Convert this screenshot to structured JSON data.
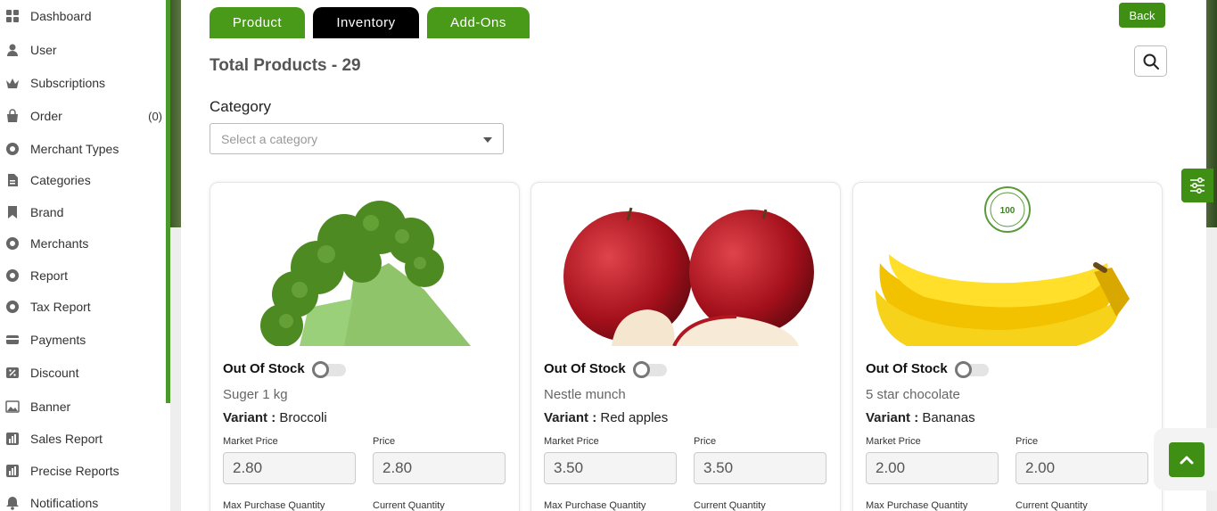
{
  "sidebar": {
    "items": [
      {
        "label": "Dashboard",
        "icon": "grid-icon"
      },
      {
        "label": "User",
        "icon": "user-icon"
      },
      {
        "label": "Subscriptions",
        "icon": "crown-icon"
      },
      {
        "label": "Order",
        "icon": "bag-icon",
        "count": "(0)"
      },
      {
        "label": "Merchant Types",
        "icon": "gear-icon"
      },
      {
        "label": "Categories",
        "icon": "document-icon"
      },
      {
        "label": "Brand",
        "icon": "bookmark-icon"
      },
      {
        "label": "Merchants",
        "icon": "gear-icon"
      },
      {
        "label": "Report",
        "icon": "gear-icon"
      },
      {
        "label": "Tax Report",
        "icon": "gear-icon"
      },
      {
        "label": "Payments",
        "icon": "card-icon"
      },
      {
        "label": "Discount",
        "icon": "percent-icon"
      },
      {
        "label": "Banner",
        "icon": "image-icon"
      },
      {
        "label": "Sales Report",
        "icon": "chart-icon"
      },
      {
        "label": "Precise Reports",
        "icon": "chart-icon"
      },
      {
        "label": "Notifications",
        "icon": "bell-icon"
      }
    ]
  },
  "tabs": [
    {
      "label": "Product",
      "active": false
    },
    {
      "label": "Inventory",
      "active": true
    },
    {
      "label": "Add-Ons",
      "active": false
    }
  ],
  "header": {
    "back_label": "Back",
    "title": "Total Products - 29"
  },
  "filter": {
    "category_label": "Category",
    "category_placeholder": "Select a category"
  },
  "products": [
    {
      "image": "broccoli",
      "out_of_stock_label": "Out Of Stock",
      "out_of_stock": false,
      "name": "Suger 1 kg",
      "variant_label": "Variant :",
      "variant": "Broccoli",
      "market_price_label": "Market Price",
      "market_price": "2.80",
      "price_label": "Price",
      "price": "2.80",
      "max_qty_label": "Max Purchase Quantity",
      "current_qty_label": "Current Quantity"
    },
    {
      "image": "red-apples",
      "out_of_stock_label": "Out Of Stock",
      "out_of_stock": false,
      "name": "Nestle munch",
      "variant_label": "Variant :",
      "variant": "Red apples",
      "market_price_label": "Market Price",
      "market_price": "3.50",
      "price_label": "Price",
      "price": "3.50",
      "max_qty_label": "Max Purchase Quantity",
      "current_qty_label": "Current Quantity"
    },
    {
      "image": "bananas",
      "badge_text": "100",
      "out_of_stock_label": "Out Of Stock",
      "out_of_stock": false,
      "name": "5 star chocolate",
      "variant_label": "Variant :",
      "variant": "Bananas",
      "market_price_label": "Market Price",
      "market_price": "2.00",
      "price_label": "Price",
      "price": "2.00",
      "max_qty_label": "Max Purchase Quantity",
      "current_qty_label": "Current Quantity"
    }
  ],
  "colors": {
    "accent": "#4a9a1a",
    "accent_dark": "#3f8f14",
    "tab_active": "#000000"
  }
}
